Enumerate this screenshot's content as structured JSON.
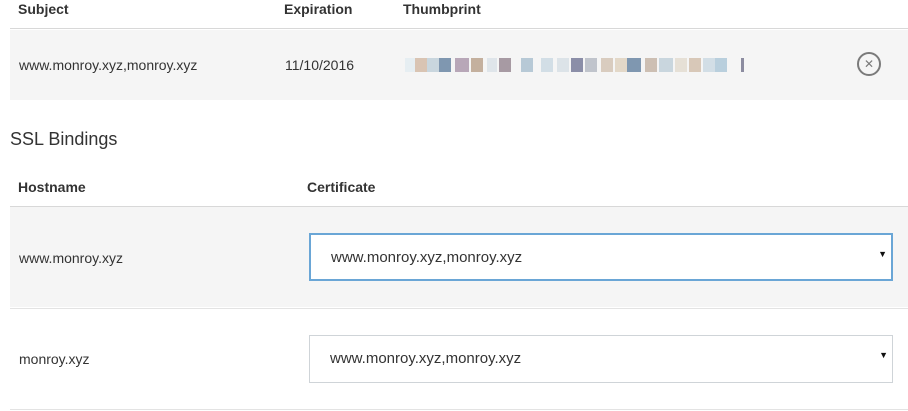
{
  "certificates": {
    "headers": {
      "subject": "Subject",
      "expiration": "Expiration",
      "thumbprint": "Thumbprint"
    },
    "rows": [
      {
        "subject": "www.monroy.xyz,monroy.xyz",
        "expiration": "11/10/2016",
        "thumbprint_state": "redacted",
        "remove_icon": "close-circle-icon"
      }
    ]
  },
  "ssl_bindings": {
    "title": "SSL Bindings",
    "headers": {
      "hostname": "Hostname",
      "certificate": "Certificate"
    },
    "rows": [
      {
        "hostname": "www.monroy.xyz",
        "certificate": "www.monroy.xyz,monroy.xyz"
      },
      {
        "hostname": "monroy.xyz",
        "certificate": "www.monroy.xyz,monroy.xyz"
      }
    ]
  },
  "colors": {
    "row_shade": "#f5f5f5",
    "focus_border": "#6aa6d6",
    "divider": "#d8d8d8"
  }
}
